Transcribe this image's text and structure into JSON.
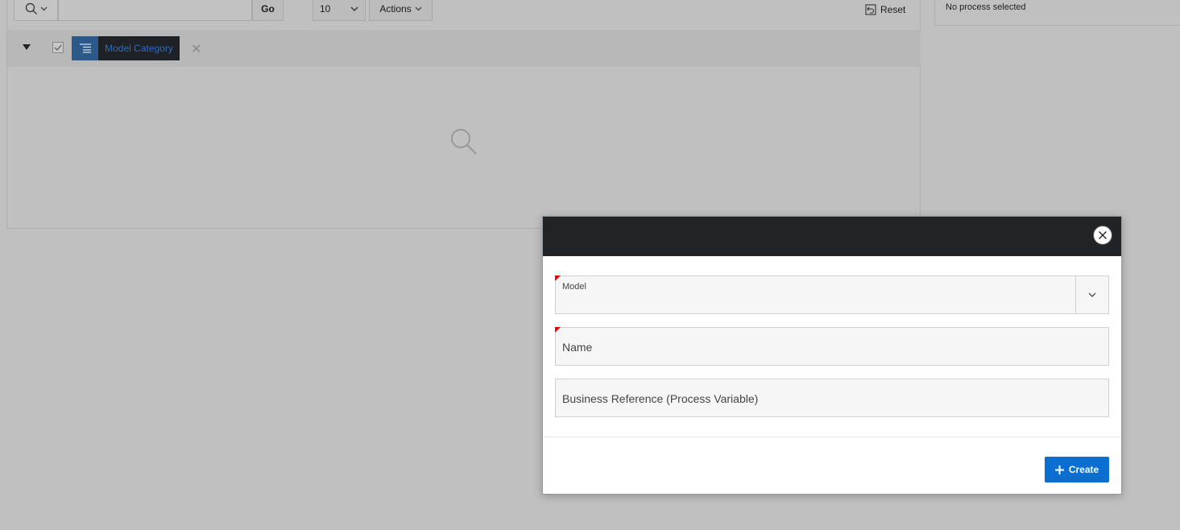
{
  "toolbar": {
    "go_label": "Go",
    "rows_value": "10",
    "actions_label": "Actions",
    "reset_label": "Reset"
  },
  "filter": {
    "chip_label": "Model Category"
  },
  "right_panel": {
    "status_text": "No process selected"
  },
  "dialog": {
    "fields": {
      "model_label": "Model",
      "name_label": "Name",
      "business_reference_label": "Business Reference (Process Variable)"
    },
    "create_label": "Create"
  },
  "colors": {
    "dialog_header": "#212427",
    "create_button": "#0b6fd1",
    "required_marker": "#e00000",
    "filter_chip_icon_bg": "#2b5a8a"
  }
}
